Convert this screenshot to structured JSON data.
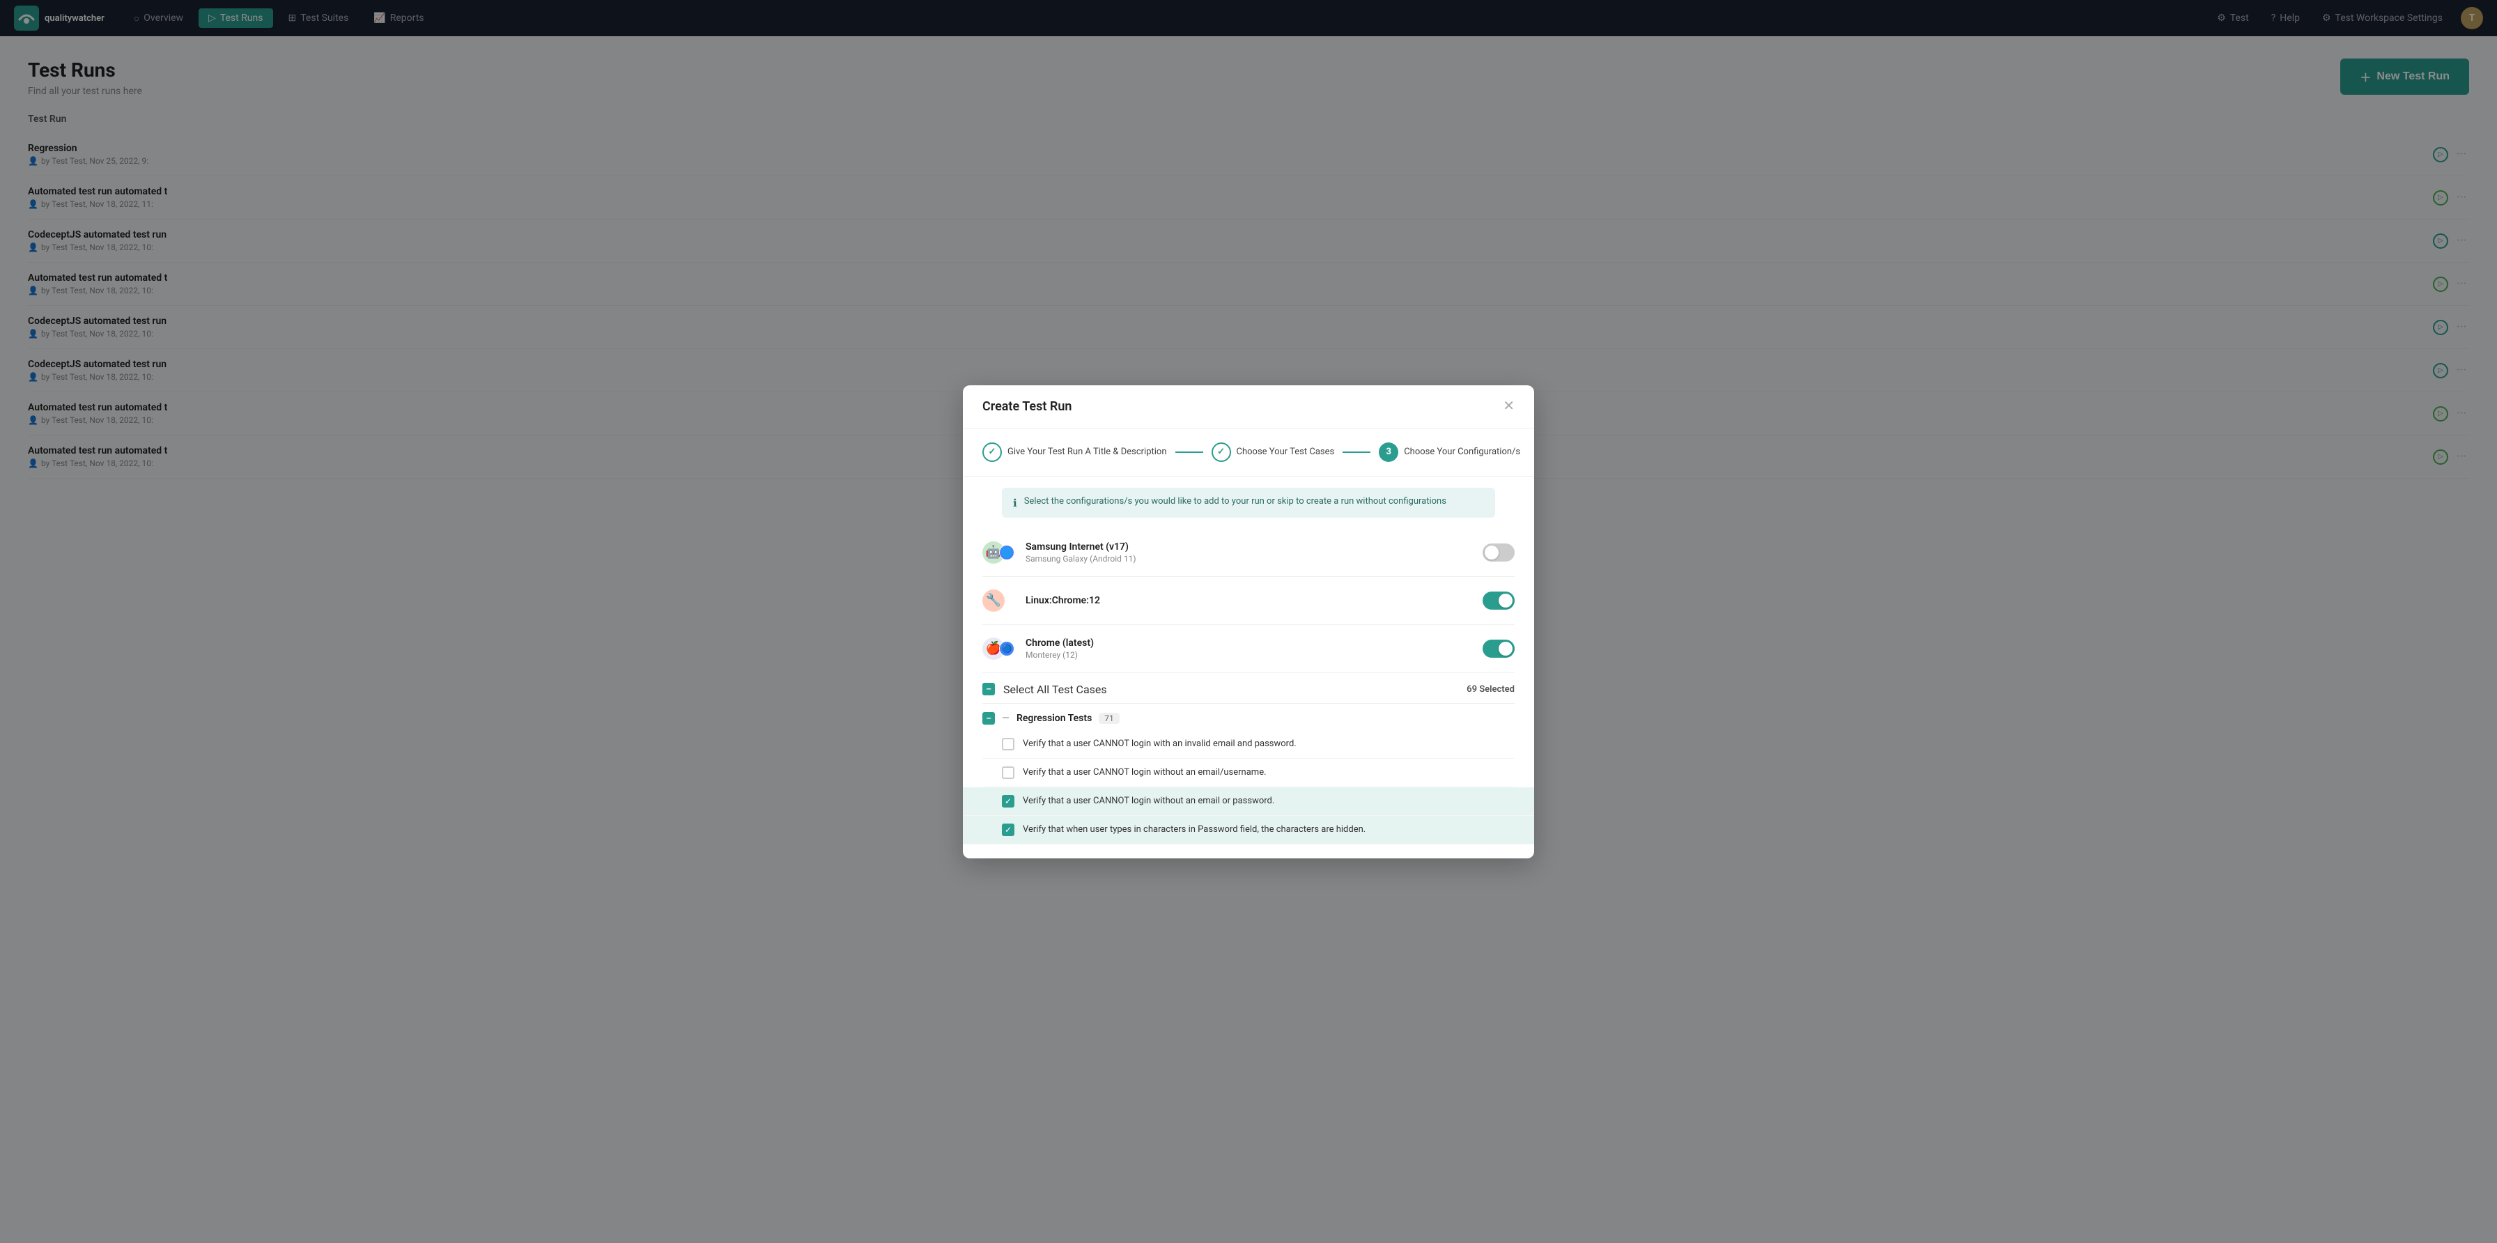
{
  "nav": {
    "logo_text": "qualitywatcher",
    "items": [
      {
        "label": "Overview",
        "icon": "circle-icon",
        "active": false
      },
      {
        "label": "Test Runs",
        "icon": "play-icon",
        "active": true
      },
      {
        "label": "Test Suites",
        "icon": "grid-icon",
        "active": false
      },
      {
        "label": "Reports",
        "icon": "chart-icon",
        "active": false
      }
    ],
    "right_items": [
      {
        "label": "Test",
        "icon": "gear-icon"
      },
      {
        "label": "Help",
        "icon": "help-icon"
      },
      {
        "label": "Test Workspace Settings",
        "icon": "settings-icon"
      }
    ],
    "avatar": "T"
  },
  "page": {
    "title": "Test Runs",
    "subtitle": "Find all your test runs here",
    "section_label": "Test Run",
    "new_run_label": "New Test Run"
  },
  "runs": [
    {
      "title": "Regression",
      "meta": "by Test Test, Nov 25, 2022, 9:",
      "status": "blue"
    },
    {
      "title": "Automated test run automated t",
      "meta": "by Test Test, Nov 18, 2022, 11:",
      "status": "green"
    },
    {
      "title": "CodeceptJS automated test run",
      "meta": "by Test Test, Nov 18, 2022, 10:",
      "status": "blue"
    },
    {
      "title": "Automated test run automated t",
      "meta": "by Test Test, Nov 18, 2022, 10:",
      "status": "green"
    },
    {
      "title": "CodeceptJS automated test run",
      "meta": "by Test Test, Nov 18, 2022, 10:",
      "status": "blue"
    },
    {
      "title": "CodeceptJS automated test run",
      "meta": "by Test Test, Nov 18, 2022, 10:",
      "status": "blue"
    },
    {
      "title": "Automated test run automated t",
      "meta": "by Test Test, Nov 18, 2022, 10:",
      "status": "green"
    },
    {
      "title": "Automated test run automated t",
      "meta": "by Test Test, Nov 18, 2022, 10:",
      "status": "green"
    }
  ],
  "modal": {
    "title": "Create Test Run",
    "steps": [
      {
        "label": "Give Your Test Run A Title & Description",
        "state": "done",
        "number": "✓"
      },
      {
        "label": "Choose Your Test Cases",
        "state": "done",
        "number": "✓"
      },
      {
        "label": "Choose Your Configuration/s",
        "state": "active",
        "number": "3"
      }
    ],
    "info_text": "Select the configurations/s you would like to add to your run or skip to create a run without configurations",
    "configs": [
      {
        "name": "Samsung Internet (v17)",
        "sub": "Samsung Galaxy (Android 11)",
        "icon1": "🤖",
        "icon1_bg": "#4caf50",
        "icon2": "🌐",
        "icon2_bg": "#1565c0",
        "enabled": false
      },
      {
        "name": "Linux:Chrome:12",
        "sub": "",
        "icon1": "⚙",
        "icon1_bg": "#e53935",
        "icon2": "",
        "icon2_bg": "",
        "enabled": true
      },
      {
        "name": "Chrome (latest)",
        "sub": "Monterey (12)",
        "icon1": "🍎",
        "icon1_bg": "#888",
        "icon2": "🔵",
        "icon2_bg": "#4285f4",
        "enabled": true
      }
    ],
    "select_all_label": "Select All Test Cases",
    "selected_count": "69 Selected",
    "groups": [
      {
        "label": "Regression Tests",
        "count": "71",
        "checked": "indeterminate",
        "cases": [
          {
            "text": "Verify that a user CANNOT login with an invalid email and password.",
            "checked": false,
            "highlighted": false
          },
          {
            "text": "Verify that a user CANNOT login without an email/username.",
            "checked": false,
            "highlighted": false
          },
          {
            "text": "Verify that a user CANNOT login without an email or password.",
            "checked": true,
            "highlighted": true
          },
          {
            "text": "Verify that when user types in characters in Password field, the characters are hidden.",
            "checked": true,
            "highlighted": true
          }
        ]
      }
    ]
  }
}
